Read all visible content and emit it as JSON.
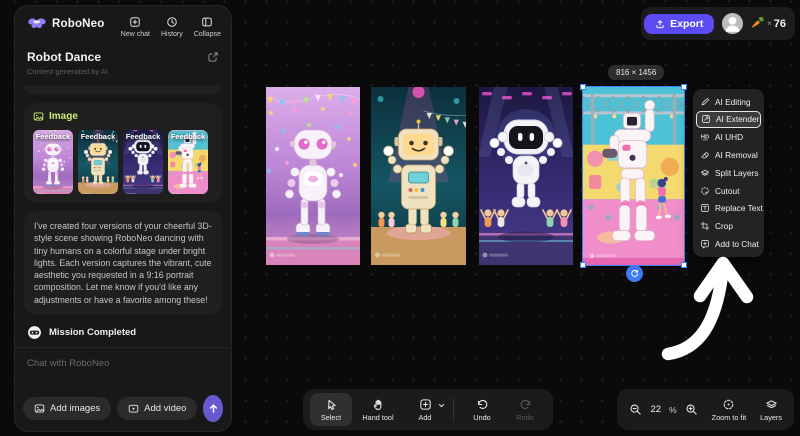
{
  "brand": {
    "name": "RoboNeo"
  },
  "header_actions": {
    "new_chat": "New chat",
    "history": "History",
    "collapse": "Collapse"
  },
  "sidebar": {
    "title": "Robot Dance",
    "subtitle": "Content generated by AI",
    "image_section": {
      "label": "Image",
      "thumbnails": [
        {
          "label": "Feedback"
        },
        {
          "label": "Feedback"
        },
        {
          "label": "Feedback"
        },
        {
          "label": "Feedback"
        }
      ]
    },
    "message": "I've created four versions of your cheerful 3D-style scene showing RoboNeo dancing with tiny humans on a colorful stage under bright lights. Each version captures the vibrant, cute aesthetic you requested in a 9:16 portrait composition. Let me know if you'd like any adjustments or have a favorite among these!",
    "status": "Mission Completed",
    "chat": {
      "placeholder": "Chat with RoboNeo",
      "add_images": "Add images",
      "add_video": "Add video"
    }
  },
  "topbar": {
    "export_label": "Export",
    "credits_icon": "🥕",
    "credits_times": "×",
    "credits_count": "76"
  },
  "canvas": {
    "dimension_label": "816 × 1456",
    "selected_index": 3,
    "images": [
      {
        "id": "variant-1",
        "scene": "lilac-ballroom",
        "alt": "white robot with pink eyes dancing under party lights"
      },
      {
        "id": "variant-2",
        "scene": "teal-stage",
        "alt": "retro cream robot with glowing smiley face on stage"
      },
      {
        "id": "variant-3",
        "scene": "indigo-disco",
        "alt": "white robot with black screen face dancing with tiny humans"
      },
      {
        "id": "variant-4",
        "scene": "teal-mech-stage",
        "alt": "tall white mech robot dancing with a girl on colorful stage"
      }
    ],
    "scenes": {
      "lilac-ballroom": {
        "sky1": "#dcaeea",
        "sky2": "#9e6cbd",
        "floor": "#d884b8",
        "robot": "#f7f2f9",
        "accent": "#e06ec8"
      },
      "teal-stage": {
        "sky1": "#0c2f3c",
        "sky2": "#155663",
        "floor": "#c89a60",
        "robot": "#efe2c0",
        "accent": "#ff57c4"
      },
      "indigo-disco": {
        "sky1": "#1d1840",
        "sky2": "#4a3c8f",
        "floor": "#3f3470",
        "robot": "#f4f4f8",
        "accent": "#e050c8"
      },
      "teal-mech-stage": {
        "sky": "#4cc2d6",
        "wall": "#f3d96e",
        "floor": "#ef8ec8",
        "robot": "#faf4f6",
        "accent": "#f06fb0"
      }
    }
  },
  "context_menu": {
    "active_item": "AI Extender",
    "items": [
      {
        "label": "AI Editing",
        "icon": "magic-pen-icon"
      },
      {
        "label": "AI Extender",
        "icon": "expand-icon"
      },
      {
        "label": "AI UHD",
        "icon": "hd-icon"
      },
      {
        "label": "AI Removal",
        "icon": "eraser-icon"
      },
      {
        "label": "Split Layers",
        "icon": "split-layers-icon"
      },
      {
        "label": "Cutout",
        "icon": "cutout-icon"
      },
      {
        "label": "Replace Text",
        "icon": "replace-text-icon"
      },
      {
        "label": "Crop",
        "icon": "crop-icon"
      },
      {
        "label": "Add to Chat",
        "icon": "add-to-chat-icon"
      }
    ]
  },
  "toolbar": {
    "select": "Select",
    "hand": "Hand tool",
    "add": "Add",
    "undo": "Undo",
    "redo": "Redo"
  },
  "zoombar": {
    "zoom_value": "22",
    "percent": "%",
    "fit": "Zoom to fit",
    "layers": "Layers"
  },
  "colors": {
    "accent_purple": "#5b4bf0",
    "selection_blue": "#3c82f6",
    "image_label_green": "#cdee6e",
    "refresh_blue": "#3e7bf2"
  }
}
